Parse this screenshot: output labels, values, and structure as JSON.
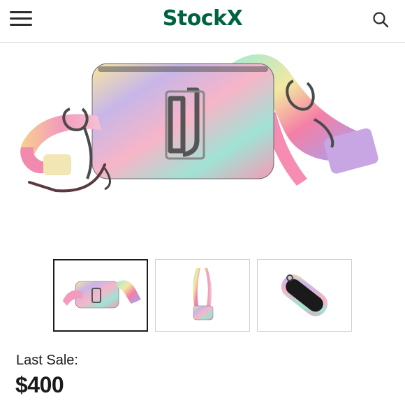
{
  "header": {
    "logo_text": "Stock",
    "logo_x": "X",
    "brand_color": "#006340",
    "menu_icon": "hamburger-menu-icon",
    "search_icon": "search-icon"
  },
  "gallery": {
    "thumbnails": [
      {
        "label": "front-view",
        "selected": true
      },
      {
        "label": "strap-view",
        "selected": false
      },
      {
        "label": "top-open-view",
        "selected": false
      }
    ]
  },
  "sale": {
    "label": "Last Sale:",
    "price": "$400"
  }
}
